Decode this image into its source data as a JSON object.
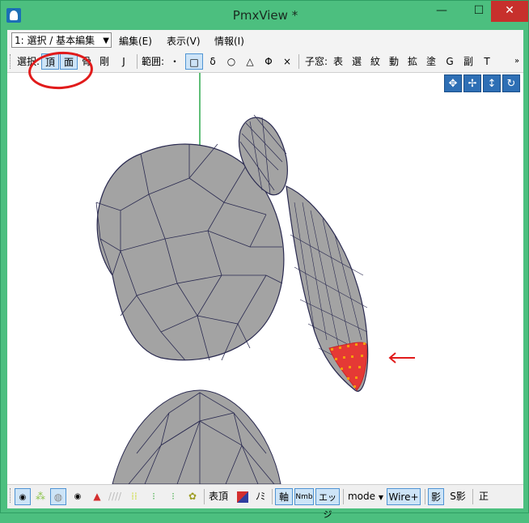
{
  "window": {
    "title": "PmxView *",
    "minimize": "—",
    "maximize": "☐",
    "close": "✕"
  },
  "menubar": {
    "mode_select": "1: 選択 / 基本編集",
    "menus": [
      "編集(E)",
      "表示(V)",
      "情報(I)"
    ]
  },
  "toolbar": {
    "select_label": "選択:",
    "select_buttons": [
      {
        "label": "頂",
        "active": true
      },
      {
        "label": "面",
        "active": true
      },
      {
        "label": "骨",
        "active": false
      },
      {
        "label": "剛",
        "active": false
      },
      {
        "label": "J",
        "active": false
      }
    ],
    "range_label": "範囲:",
    "range_buttons": [
      {
        "label": "・",
        "active": false
      },
      {
        "label": "□",
        "active": true
      },
      {
        "label": "δ",
        "active": false
      },
      {
        "label": "○",
        "active": false
      },
      {
        "label": "△",
        "active": false
      },
      {
        "label": "Φ",
        "active": false
      },
      {
        "label": "×",
        "active": false
      }
    ],
    "child_window_label": "子窓:",
    "child_window_buttons": [
      "表",
      "選",
      "紋",
      "動",
      "拡",
      "塗",
      "G",
      "副",
      "T"
    ],
    "overflow": "»"
  },
  "camera_icons": [
    "move-icon",
    "pan-icon",
    "zoom-icon",
    "rotate-icon"
  ],
  "bottombar": {
    "vertex_label": "表頂",
    "edge_label": "軸",
    "nmb_label": "Nmb",
    "edge2_label": "エッジ",
    "mode_label": "mode",
    "wire_label": "Wire+",
    "shadow_label": "影",
    "sshadow_label": "S影",
    "front_label": "正",
    "no_label": "ﾉﾐ"
  },
  "colors": {
    "accent": "#4cbf7f",
    "selection": "#e53935",
    "mesh": "#9e9e9e",
    "wire": "#2a2a50",
    "annotation": "#e11b1b"
  }
}
